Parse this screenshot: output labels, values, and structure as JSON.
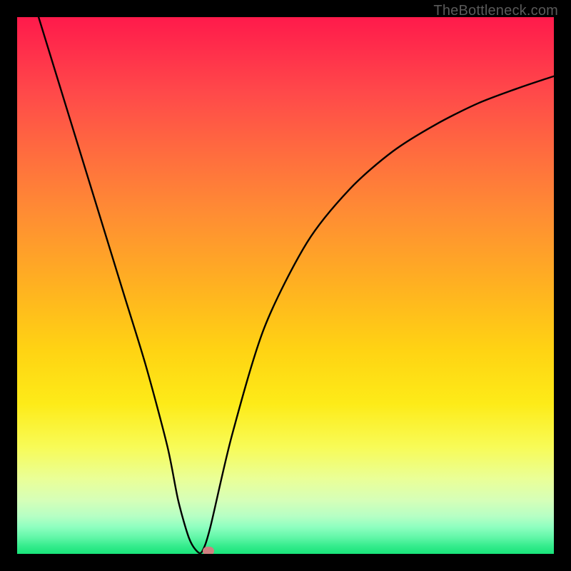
{
  "watermark": "TheBottleneck.com",
  "colors": {
    "frame_bg": "#000000",
    "curve": "#000000",
    "marker": "#d08080",
    "watermark_text": "#5a5a5a"
  },
  "chart_data": {
    "type": "line",
    "title": "",
    "xlabel": "",
    "ylabel": "",
    "xlim": [
      0,
      100
    ],
    "ylim": [
      0,
      100
    ],
    "grid": false,
    "legend": false,
    "series": [
      {
        "name": "bottleneck-curve",
        "x": [
          4,
          8,
          12,
          16,
          20,
          24,
          28,
          30,
          32,
          33.5,
          34.5,
          36,
          40,
          46,
          54,
          62,
          70,
          78,
          86,
          94,
          100
        ],
        "y": [
          100,
          87,
          74,
          61,
          48,
          35,
          20,
          10,
          3,
          0.5,
          0.5,
          5,
          22,
          42,
          58,
          68,
          75,
          80,
          84,
          87,
          89
        ]
      }
    ],
    "annotations": [
      {
        "name": "optimal-marker",
        "x": 35.7,
        "y": 0.5
      }
    ],
    "background": {
      "type": "vertical-gradient",
      "stops": [
        {
          "pos": 0.0,
          "color": "#ff1a4b"
        },
        {
          "pos": 0.5,
          "color": "#ffb121"
        },
        {
          "pos": 0.8,
          "color": "#f8fb56"
        },
        {
          "pos": 1.0,
          "color": "#18e47a"
        }
      ]
    }
  }
}
